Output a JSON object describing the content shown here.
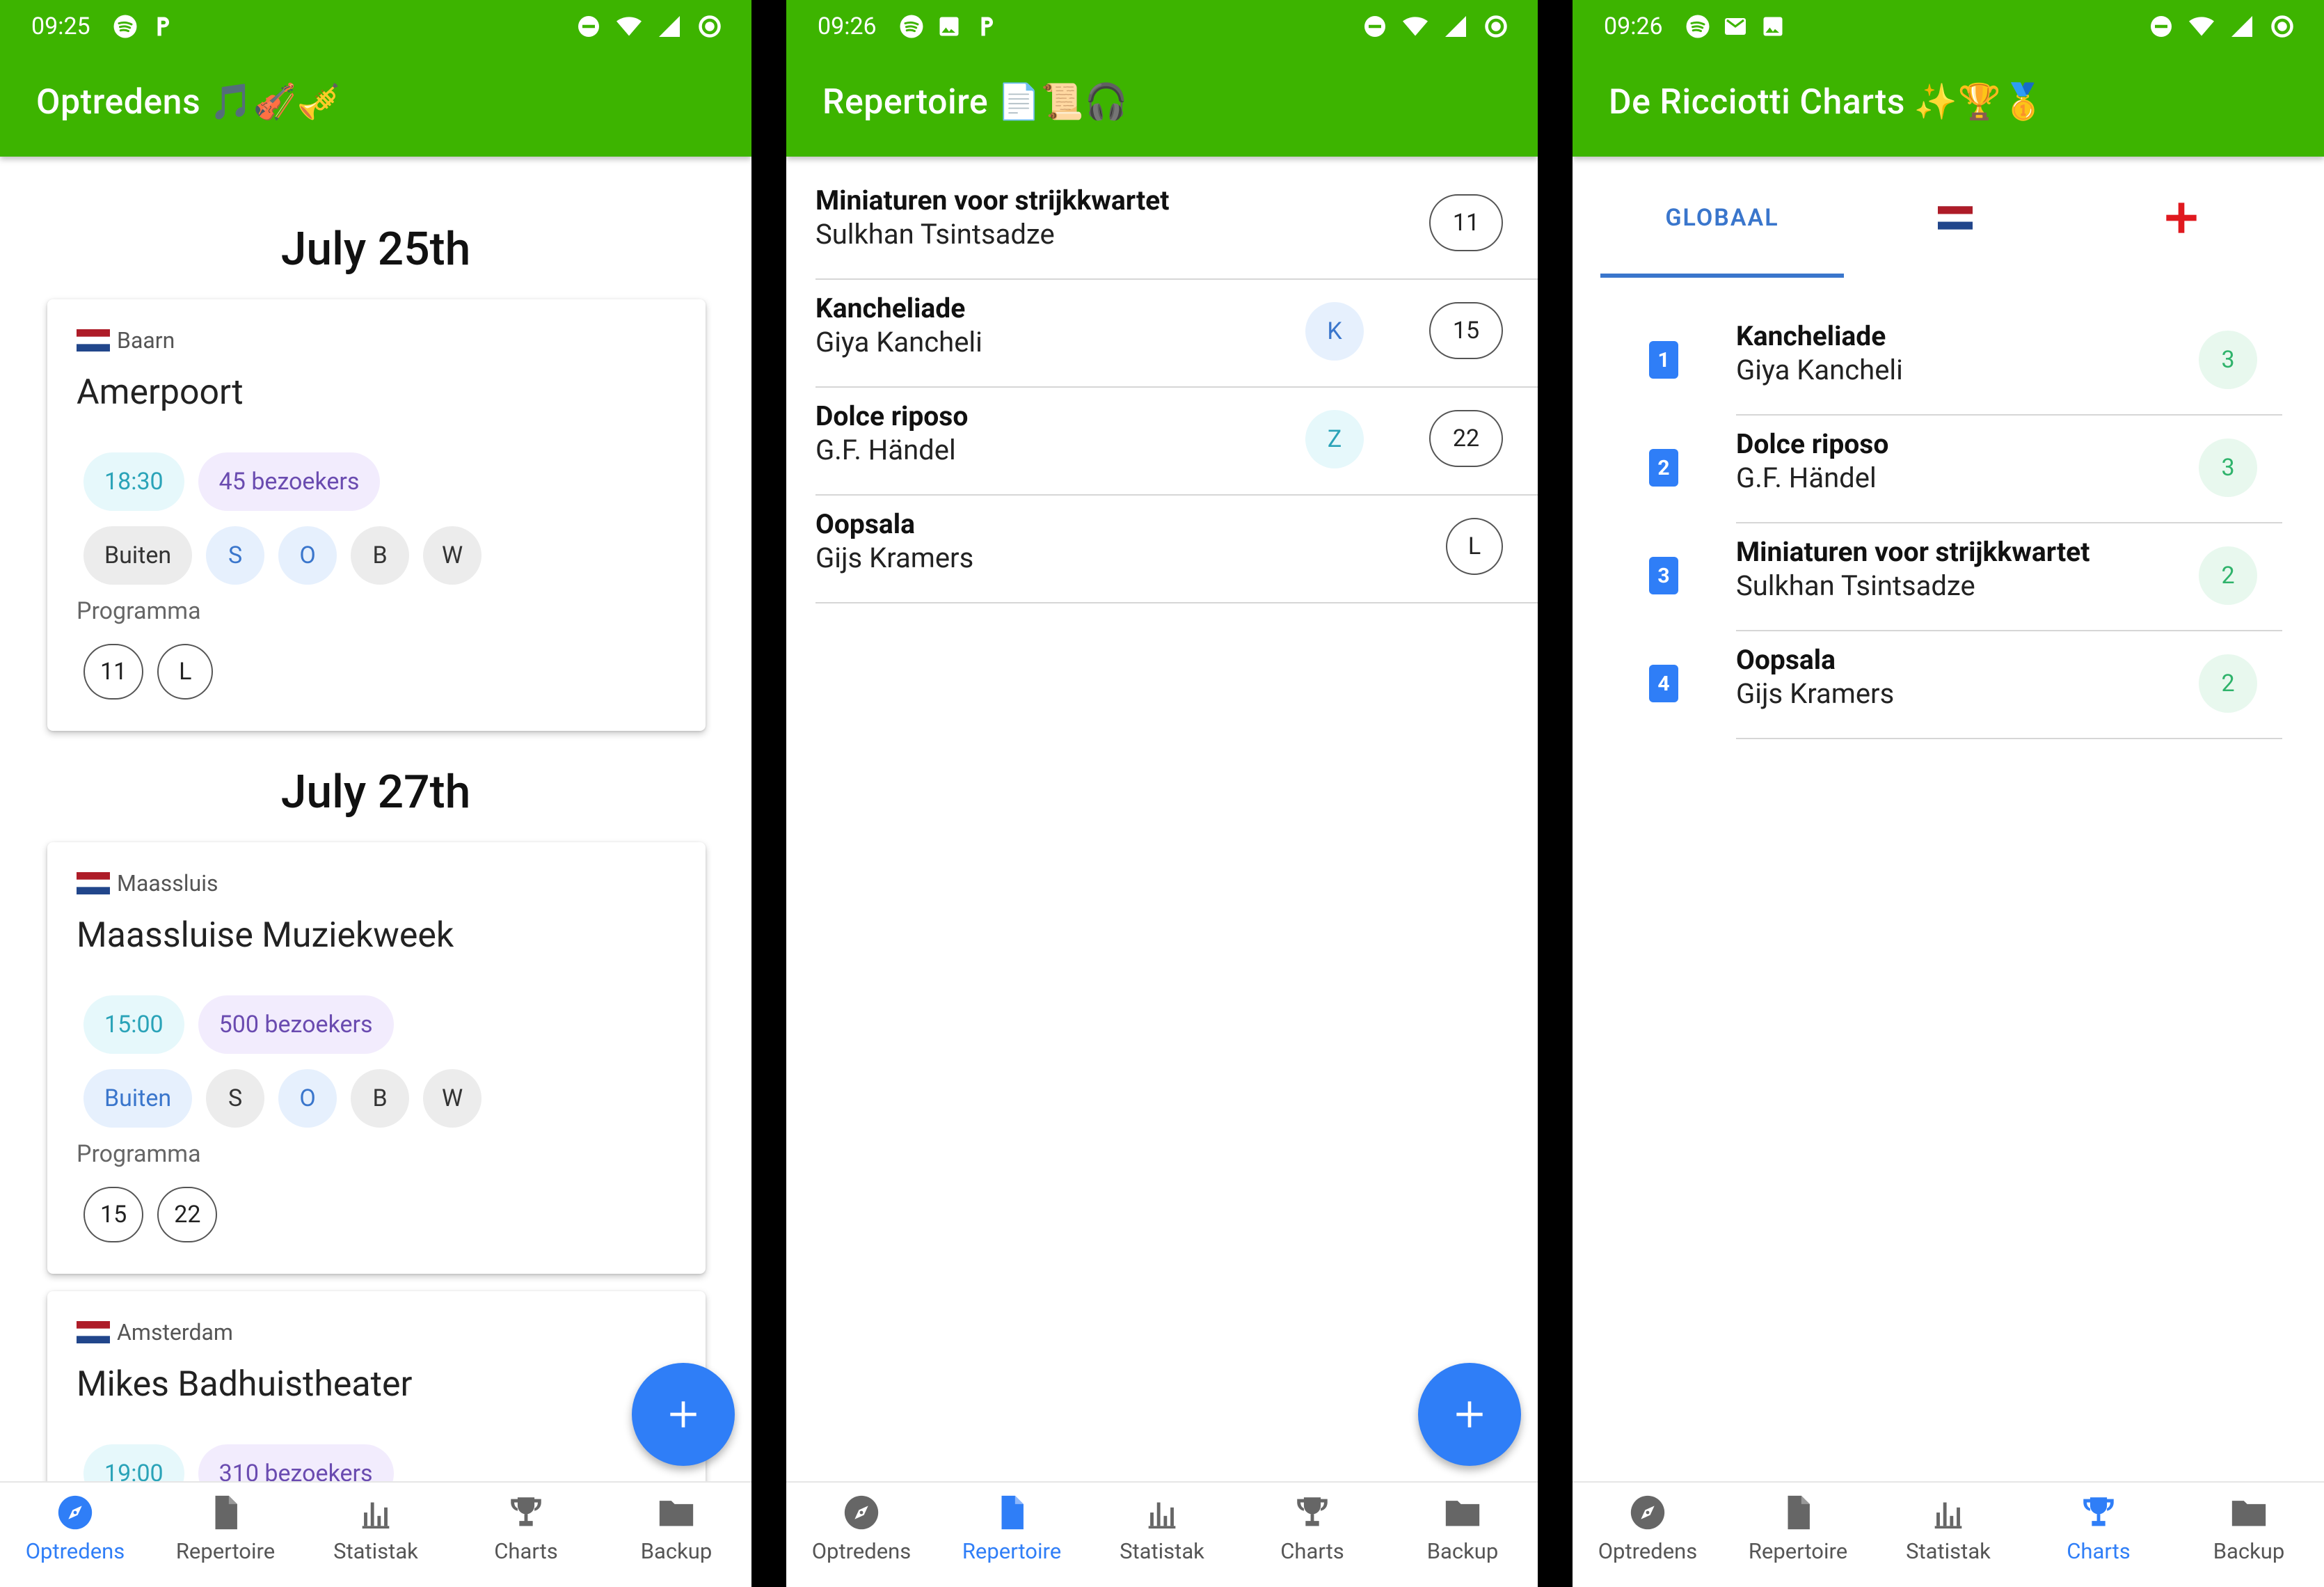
{
  "status": {
    "phone1_time": "09:25",
    "phone2_time": "09:26",
    "phone3_time": "09:26"
  },
  "titles": {
    "optredens": "Optredens 🎵🎻🎺",
    "repertoire": "Repertoire 📄📜🎧",
    "charts": "De Ricciotti Charts ✨🏆🥇"
  },
  "nav": {
    "items": [
      "Optredens",
      "Repertoire",
      "Statistak",
      "Charts",
      "Backup"
    ]
  },
  "optredens": {
    "dates": [
      "July 25th",
      "July 27th"
    ],
    "programma_label": "Programma",
    "cards": [
      {
        "location": "Baarn",
        "venue": "Amerpoort",
        "time": "18:30",
        "visitors": "45 bezoekers",
        "setting": "Buiten",
        "tags": [
          "S",
          "O",
          "B",
          "W"
        ],
        "program": [
          "11",
          "L"
        ]
      },
      {
        "location": "Maassluis",
        "venue": "Maassluise Muziekweek",
        "time": "15:00",
        "visitors": "500 bezoekers",
        "setting": "Buiten",
        "tags": [
          "S",
          "O",
          "B",
          "W"
        ],
        "program": [
          "15",
          "22"
        ]
      },
      {
        "location": "Amsterdam",
        "venue": "Mikes Badhuistheater",
        "time": "19:00",
        "visitors": "310 bezoekers"
      }
    ]
  },
  "repertoire": {
    "items": [
      {
        "title": "Miniaturen voor strijkkwartet",
        "composer": "Sulkhan Tsintsadze",
        "number": "11",
        "tag": ""
      },
      {
        "title": "Kancheliade",
        "composer": "Giya Kancheli",
        "number": "15",
        "tag": "K"
      },
      {
        "title": "Dolce riposo",
        "composer": "G.F. Händel",
        "number": "22",
        "tag": "Z"
      },
      {
        "title": "Oopsala",
        "composer": "Gijs Kramers",
        "number": "L",
        "tag": ""
      }
    ]
  },
  "charts": {
    "tabs": [
      "GLOBAAL",
      "nl-flag",
      "england-flag"
    ],
    "ranking": [
      {
        "rank": "1",
        "title": "Kancheliade",
        "composer": "Giya Kancheli",
        "score": "3"
      },
      {
        "rank": "2",
        "title": "Dolce riposo",
        "composer": "G.F. Händel",
        "score": "3"
      },
      {
        "rank": "3",
        "title": "Miniaturen voor strijkkwartet",
        "composer": "Sulkhan Tsintsadze",
        "score": "2"
      },
      {
        "rank": "4",
        "title": "Oopsala",
        "composer": "Gijs Kramers",
        "score": "2"
      }
    ]
  },
  "colors": {
    "appbar": "#3db400",
    "accent": "#2f7ef7"
  }
}
